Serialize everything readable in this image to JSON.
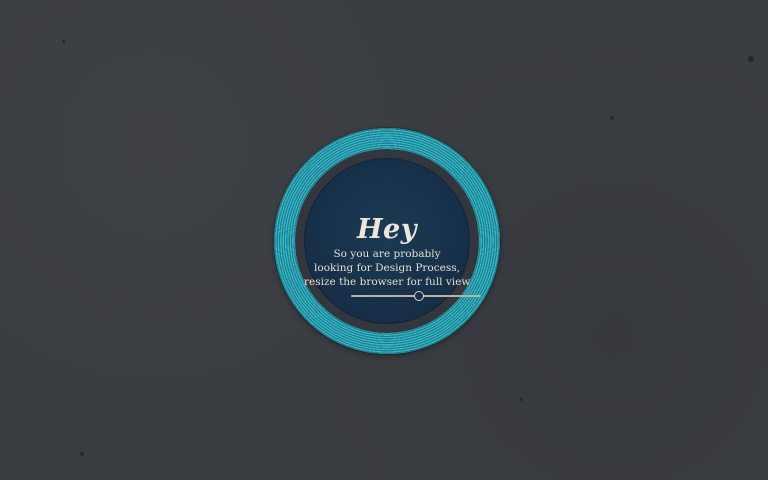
{
  "badge": {
    "heading": "Hey",
    "message_lines": [
      "So you are probably",
      "looking for Design Process,",
      "resize the browser for full view"
    ],
    "slider_value": 0.5
  },
  "colors": {
    "background": "#3a3d42",
    "ring_teal": "#35b7c8",
    "inner_navy": "#173049",
    "text_cream": "#ece7d8"
  }
}
